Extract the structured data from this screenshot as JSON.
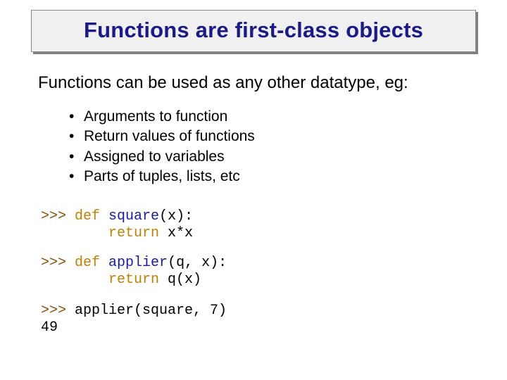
{
  "title": "Functions are first-class objects",
  "subheading": "Functions can be used as any other datatype, eg:",
  "bullets": [
    "Arguments to function",
    "Return values of functions",
    "Assigned to variables",
    "Parts of tuples, lists, etc"
  ],
  "code": {
    "prompt": ">>> ",
    "def": "def",
    "return": "return",
    "block1": {
      "fn": "square",
      "sig_open": "(",
      "args": "x",
      "sig_close": "):",
      "indent": "        ",
      "ret_expr": " x*x"
    },
    "block2": {
      "fn": "applier",
      "sig_open": "(",
      "args": "q, x",
      "sig_close": "):",
      "indent": "        ",
      "ret_expr": " q(x)"
    },
    "block3": {
      "call": "applier(square, 7)",
      "result": "49"
    }
  }
}
